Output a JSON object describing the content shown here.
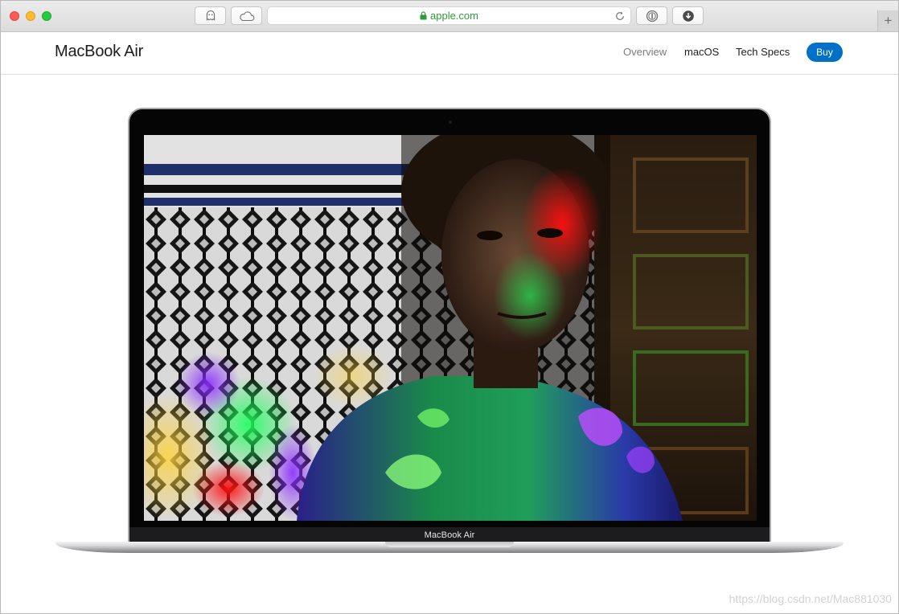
{
  "browser": {
    "url": "apple.com",
    "icons": {
      "ghost": "ghost-icon",
      "cloud": "icloud-icon",
      "lock": "lock-icon",
      "reload": "reload-icon",
      "password": "password-manager-icon",
      "download": "download-icon",
      "new_tab": "plus-icon"
    },
    "new_tab_label": "+"
  },
  "nav": {
    "title": "MacBook Air",
    "links": [
      "Overview",
      "macOS",
      "Tech Specs"
    ],
    "buy_label": "Buy",
    "buy_color": "#0070c9"
  },
  "hero": {
    "device_label": "MacBook Air"
  },
  "watermark": "https://blog.csdn.net/Mac881030"
}
